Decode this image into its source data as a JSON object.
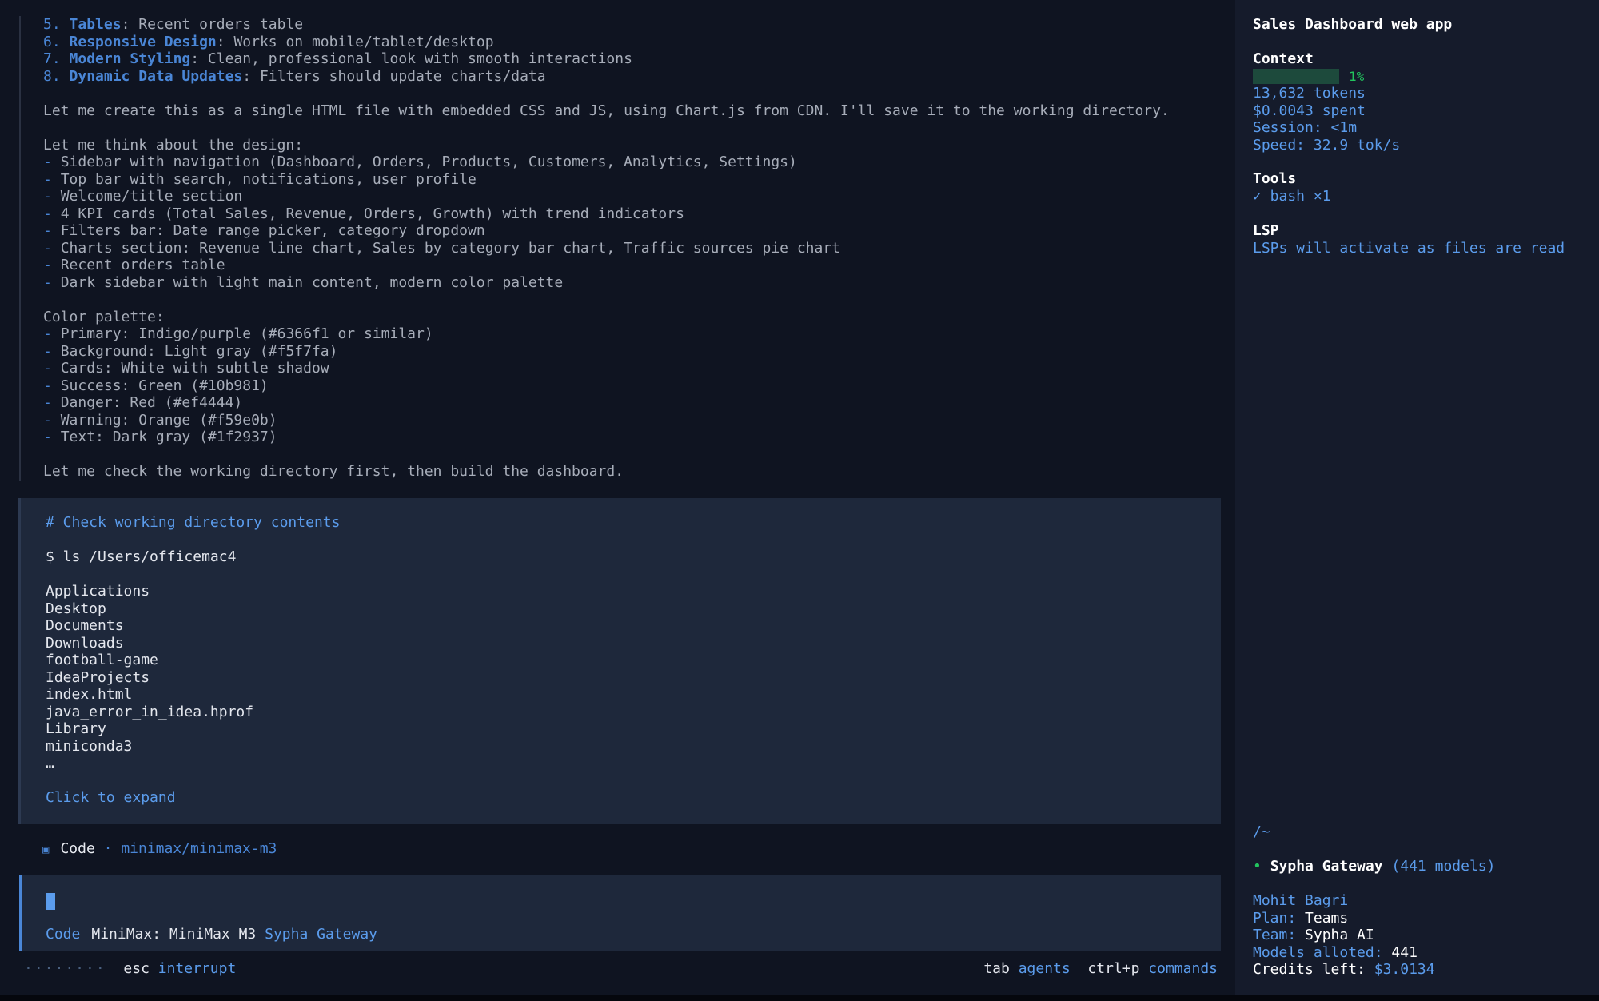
{
  "reasoning": {
    "list_items": [
      {
        "num": "5.",
        "title": "Tables",
        "text": ": Recent orders table"
      },
      {
        "num": "6.",
        "title": "Responsive Design",
        "text": ": Works on mobile/tablet/desktop"
      },
      {
        "num": "7.",
        "title": "Modern Styling",
        "text": ": Clean, professional look with smooth interactions"
      },
      {
        "num": "8.",
        "title": "Dynamic Data Updates",
        "text": ": Filters should update charts/data"
      }
    ],
    "para1": "Let me create this as a single HTML file with embedded CSS and JS, using Chart.js from CDN. I'll save it to the working directory.",
    "design_heading": "Let me think about the design:",
    "design_items": [
      "Sidebar with navigation (Dashboard, Orders, Products, Customers, Analytics, Settings)",
      "Top bar with search, notifications, user profile",
      "Welcome/title section",
      "4 KPI cards (Total Sales, Revenue, Orders, Growth) with trend indicators",
      "Filters bar: Date range picker, category dropdown",
      "Charts section: Revenue line chart, Sales by category bar chart, Traffic sources pie chart",
      "Recent orders table",
      "Dark sidebar with light main content, modern color palette"
    ],
    "palette_heading": "Color palette:",
    "palette_items": [
      "Primary: Indigo/purple (#6366f1 or similar)",
      "Background: Light gray (#f5f7fa)",
      "Cards: White with subtle shadow",
      "Success: Green (#10b981)",
      "Danger: Red (#ef4444)",
      "Warning: Orange (#f59e0b)",
      "Text: Dark gray (#1f2937)"
    ],
    "closing": "Let me check the working directory first, then build the dashboard.",
    "dash": "-"
  },
  "tool": {
    "comment": "# Check working directory contents",
    "command": "$ ls /Users/officemac4",
    "output": [
      "Applications",
      "Desktop",
      "Documents",
      "Downloads",
      "football-game",
      "IdeaProjects",
      "index.html",
      "java_error_in_idea.hprof",
      "Library",
      "miniconda3",
      "…"
    ],
    "expand_label": "Click to expand"
  },
  "model_line": {
    "icon": "▣",
    "mode": "Code",
    "sep": "·",
    "model": "minimax/minimax-m3"
  },
  "input": {
    "mode": "Code",
    "model": "MiniMax: MiniMax M3",
    "gateway": "Sypha Gateway"
  },
  "footer": {
    "dots": "········",
    "esc_key": "esc",
    "esc_action": "interrupt",
    "tab_key": "tab",
    "tab_action": "agents",
    "cmd_key": "ctrl+p",
    "cmd_action": "commands"
  },
  "sidebar": {
    "title": "Sales Dashboard web app",
    "context_heading": "Context",
    "context_percent": "1%",
    "context_fraction": 0.01,
    "tokens": "13,632 tokens",
    "spent": "$0.0043 spent",
    "session": "Session: <1m",
    "speed": "Speed: 32.9 tok/s",
    "tools_heading": "Tools",
    "tools_item": "✓ bash ×1",
    "lsp_heading": "LSP",
    "lsp_text": "LSPs will activate as files are read",
    "cwd": "/~",
    "gateway_dot": "•",
    "gateway_name": "Sypha Gateway",
    "gateway_models": "(441 models)",
    "user_name": "Mohit Bagri",
    "plan_label": "Plan:",
    "plan_value": "Teams",
    "team_label": "Team:",
    "team_value": "Sypha AI",
    "models_label": "Models alloted:",
    "models_value": "441",
    "credits_label": "Credits left:",
    "credits_value": "$3.0134"
  },
  "colors": {
    "accent": "#4a86d6",
    "success": "#22c55e",
    "panel": "#1e283b",
    "background": "#0f1421"
  }
}
